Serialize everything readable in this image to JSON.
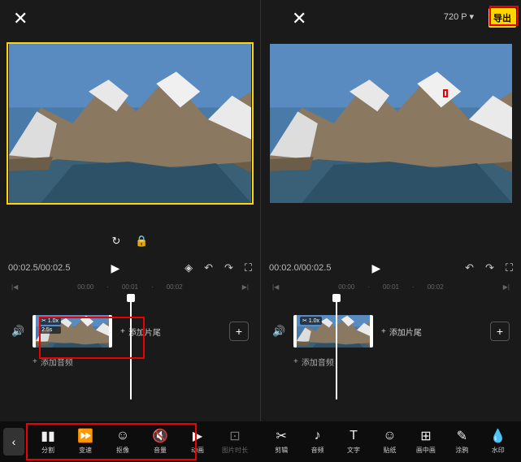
{
  "left": {
    "close": "✕",
    "timecode": "00:02.5/00:02.5",
    "ruler": [
      "00:00",
      "00:01",
      "00:02"
    ],
    "clip": {
      "speed": "✂ 1.0x",
      "duration": "2.5s"
    },
    "add_tail": "添加片尾",
    "add_audio": "添加音频",
    "toolbar": [
      {
        "icon": "▮▮",
        "label": "分割"
      },
      {
        "icon": "⏩",
        "label": "变速"
      },
      {
        "icon": "☺",
        "label": "抠像"
      },
      {
        "icon": "🔇",
        "label": "音量"
      },
      {
        "icon": "▶",
        "label": "动画"
      },
      {
        "icon": "⊡",
        "label": "图片时长"
      }
    ]
  },
  "right": {
    "close": "✕",
    "resolution": "720 P ▾",
    "export": "导出",
    "timecode": "00:02.0/00:02.5",
    "ruler": [
      "00:00",
      "00:01",
      "00:02"
    ],
    "clip": {
      "speed": "✂ 1.0x"
    },
    "add_tail": "添加片尾",
    "add_audio": "添加音频",
    "toolbar": [
      {
        "icon": "✂",
        "label": "剪辑"
      },
      {
        "icon": "♪",
        "label": "音频"
      },
      {
        "icon": "T",
        "label": "文字"
      },
      {
        "icon": "☺",
        "label": "贴纸"
      },
      {
        "icon": "⊞",
        "label": "画中画"
      },
      {
        "icon": "✎",
        "label": "涂鸦"
      },
      {
        "icon": "💧",
        "label": "水印"
      }
    ]
  },
  "mid": {
    "reset": "↻",
    "lock": "🔒"
  },
  "play_controls": {
    "play": "▶",
    "keyframe": "◈",
    "undo": "↶",
    "redo": "↷",
    "fullscreen": "⛶"
  },
  "ruler_nav": {
    "prev": "|◀",
    "next": "▶|"
  }
}
